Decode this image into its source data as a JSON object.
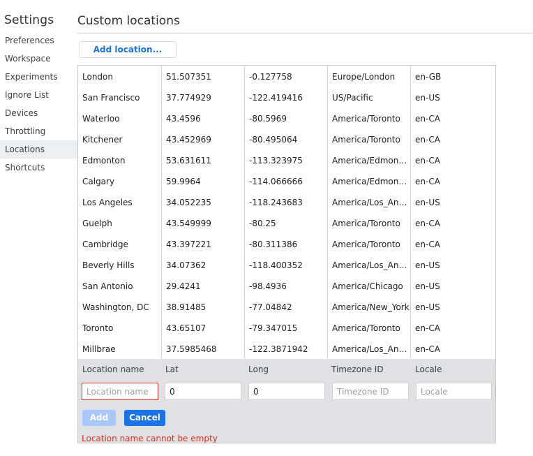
{
  "sidebar": {
    "title": "Settings",
    "items": [
      {
        "label": "Preferences"
      },
      {
        "label": "Workspace"
      },
      {
        "label": "Experiments"
      },
      {
        "label": "Ignore List"
      },
      {
        "label": "Devices"
      },
      {
        "label": "Throttling"
      },
      {
        "label": "Locations",
        "selected": true
      },
      {
        "label": "Shortcuts"
      }
    ]
  },
  "main": {
    "title": "Custom locations",
    "add_button_label": "Add location..."
  },
  "locations": [
    {
      "name": "London",
      "lat": "51.507351",
      "long": "-0.127758",
      "timezone": "Europe/London",
      "locale": "en-GB"
    },
    {
      "name": "San Francisco",
      "lat": "37.774929",
      "long": "-122.419416",
      "timezone": "US/Pacific",
      "locale": "en-US"
    },
    {
      "name": "Waterloo",
      "lat": "43.4596",
      "long": "-80.5969",
      "timezone": "America/Toronto",
      "locale": "en-CA"
    },
    {
      "name": "Kitchener",
      "lat": "43.452969",
      "long": "-80.495064",
      "timezone": "America/Toronto",
      "locale": "en-CA"
    },
    {
      "name": "Edmonton",
      "lat": "53.631611",
      "long": "-113.323975",
      "timezone": "America/Edmonton",
      "locale": "en-CA"
    },
    {
      "name": "Calgary",
      "lat": "59.9964",
      "long": "-114.066666",
      "timezone": "America/Edmonton",
      "locale": "en-CA"
    },
    {
      "name": "Los Angeles",
      "lat": "34.052235",
      "long": "-118.243683",
      "timezone": "America/Los_Angeles",
      "locale": "en-US"
    },
    {
      "name": "Guelph",
      "lat": "43.549999",
      "long": "-80.25",
      "timezone": "America/Toronto",
      "locale": "en-CA"
    },
    {
      "name": "Cambridge",
      "lat": "43.397221",
      "long": "-80.311386",
      "timezone": "America/Toronto",
      "locale": "en-CA"
    },
    {
      "name": "Beverly Hills",
      "lat": "34.07362",
      "long": "-118.400352",
      "timezone": "America/Los_Angeles",
      "locale": "en-US"
    },
    {
      "name": "San Antonio",
      "lat": "29.4241",
      "long": "-98.4936",
      "timezone": "America/Chicago",
      "locale": "en-US"
    },
    {
      "name": "Washington, DC",
      "lat": "38.91485",
      "long": "-77.04842",
      "timezone": "America/New_York",
      "locale": "en-US"
    },
    {
      "name": "Toronto",
      "lat": "43.65107",
      "long": "-79.347015",
      "timezone": "America/Toronto",
      "locale": "en-CA"
    },
    {
      "name": "Millbrae",
      "lat": "37.5985468",
      "long": "-122.3871942",
      "timezone": "America/Los_Angeles",
      "locale": "en-CA"
    }
  ],
  "editor": {
    "labels": {
      "name": "Location name",
      "lat": "Lat",
      "long": "Long",
      "timezone": "Timezone ID",
      "locale": "Locale"
    },
    "placeholders": {
      "name": "Location name",
      "timezone": "Timezone ID",
      "locale": "Locale"
    },
    "values": {
      "name": "",
      "lat": "0",
      "long": "0",
      "timezone": "",
      "locale": ""
    },
    "add_label": "Add",
    "cancel_label": "Cancel",
    "error": "Location name cannot be empty"
  },
  "colors": {
    "accent": "#1a73e8",
    "error": "#d93025",
    "add_disabled": "#a8c7fa",
    "editor_bg": "#dfe1e5"
  }
}
